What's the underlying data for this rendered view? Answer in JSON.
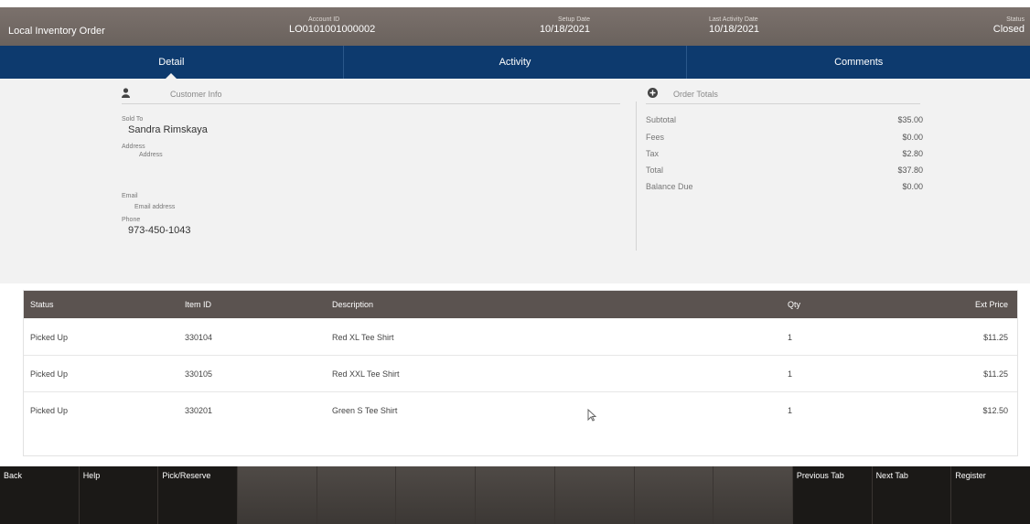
{
  "header": {
    "title": "Local Inventory Order",
    "account_id_label": "Account ID",
    "account_id": "LO0101001000002",
    "setup_date_label": "Setup Date",
    "setup_date": "10/18/2021",
    "last_activity_label": "Last Activity Date",
    "last_activity": "10/18/2021",
    "status_label": "Status",
    "status": "Closed"
  },
  "tabs": [
    {
      "label": "Detail",
      "active": true
    },
    {
      "label": "Activity",
      "active": false
    },
    {
      "label": "Comments",
      "active": false
    }
  ],
  "customer": {
    "heading": "Customer Info",
    "icon": "person-icon",
    "sold_to_label": "Sold To",
    "sold_to": "Sandra Rimskaya",
    "address_label": "Address",
    "address_placeholder": "Address",
    "email_label": "Email",
    "email_placeholder": "Email address",
    "phone_label": "Phone",
    "phone": "973-450-1043"
  },
  "totals": {
    "heading": "Order Totals",
    "icon": "plus-circle-icon",
    "rows": [
      {
        "label": "Subtotal",
        "value": "$35.00"
      },
      {
        "label": "Fees",
        "value": "$0.00"
      },
      {
        "label": "Tax",
        "value": "$2.80"
      },
      {
        "label": "Total",
        "value": "$37.80"
      },
      {
        "label": "Balance Due",
        "value": "$0.00"
      }
    ]
  },
  "table": {
    "headers": {
      "status": "Status",
      "item_id": "Item ID",
      "description": "Description",
      "qty": "Qty",
      "ext_price": "Ext Price"
    },
    "rows": [
      {
        "status": "Picked Up",
        "item_id": "330104",
        "description": "Red XL Tee Shirt",
        "qty": "1",
        "ext_price": "$11.25"
      },
      {
        "status": "Picked Up",
        "item_id": "330105",
        "description": "Red XXL Tee Shirt",
        "qty": "1",
        "ext_price": "$11.25"
      },
      {
        "status": "Picked Up",
        "item_id": "330201",
        "description": "Green S Tee Shirt",
        "qty": "1",
        "ext_price": "$12.50"
      }
    ]
  },
  "buttons": [
    "Back",
    "Help",
    "Pick/Reserve",
    "",
    "",
    "",
    "",
    "",
    "",
    "",
    "Previous Tab",
    "Next Tab",
    "Register"
  ],
  "colors": {
    "tab_bar": "#0d3a6e",
    "header": "#6f6661",
    "table_header": "#5b5350",
    "button_bar": "#1b1917"
  }
}
